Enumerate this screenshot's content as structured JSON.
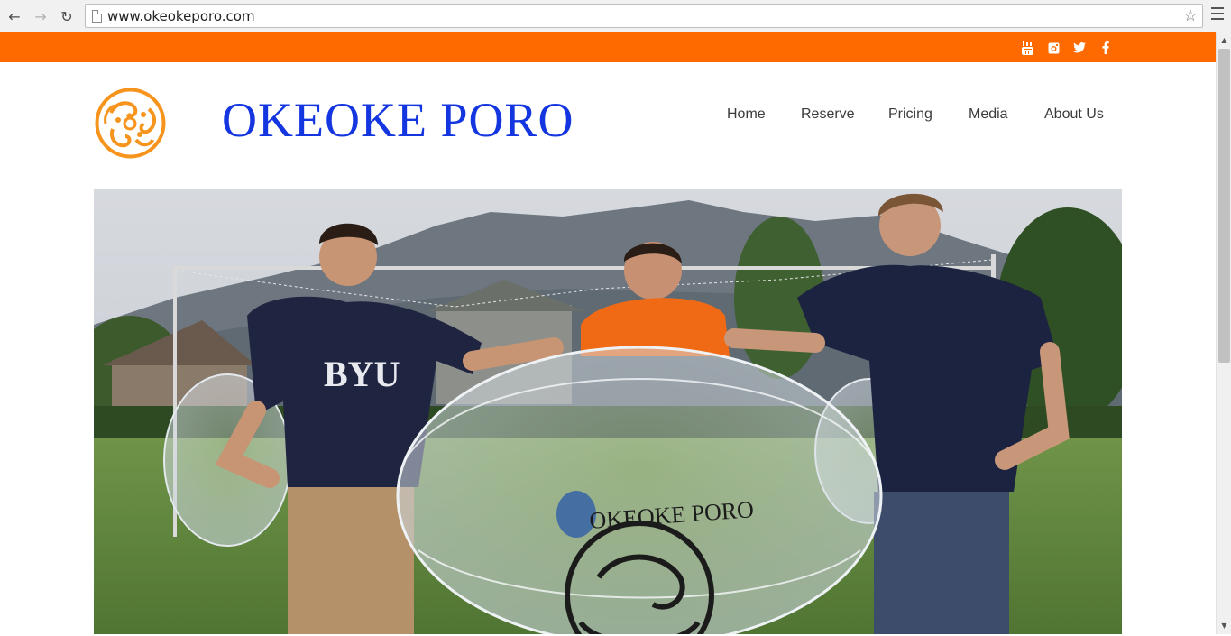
{
  "browser": {
    "url": "www.okeokeporo.com",
    "back_icon": "back-arrow-icon",
    "forward_icon": "forward-arrow-icon",
    "reload_icon": "reload-icon",
    "star_icon": "bookmark-star-icon",
    "menu_icon": "hamburger-menu-icon"
  },
  "topbar": {
    "color": "#ff6a00",
    "social": [
      "youtube-icon",
      "instagram-icon",
      "twitter-icon",
      "facebook-icon"
    ]
  },
  "site": {
    "title": "OKEOKE PORO",
    "title_color": "#1436e0",
    "logo_color": "#f7941d"
  },
  "nav": {
    "items": [
      {
        "label": "Home"
      },
      {
        "label": "Reserve"
      },
      {
        "label": "Pricing"
      },
      {
        "label": "Media"
      },
      {
        "label": "About Us"
      }
    ]
  },
  "hero": {
    "shirt_text": "BYU",
    "ball_text": "OKEOKE PORO"
  }
}
